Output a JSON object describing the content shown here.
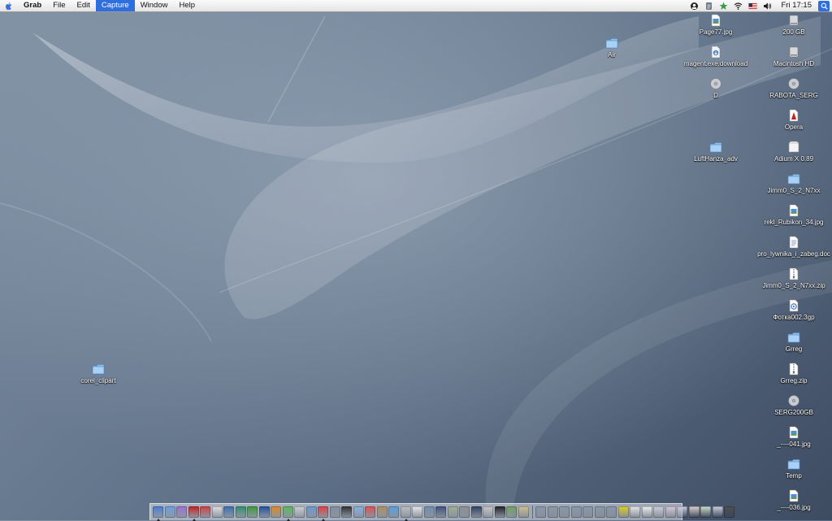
{
  "menubar": {
    "app_name": "Grab",
    "menus": [
      "File",
      "Edit",
      "Capture",
      "Window",
      "Help"
    ],
    "active_menu": "Capture",
    "clock": "Fri 17:15",
    "extras": [
      "activity-monitor-icon",
      "script-menu-icon",
      "bluetooth-star-icon",
      "wifi-icon",
      "us-flag-icon",
      "volume-icon"
    ]
  },
  "desktop_icons": {
    "air": {
      "label": "Air",
      "icon": "folder-icon"
    },
    "page77": {
      "label": "Page77.jpg",
      "icon": "image-file-icon"
    },
    "magent": {
      "label": "magent.exe.download",
      "icon": "download-file-icon"
    },
    "d_drive": {
      "label": "D",
      "icon": "drive-icon"
    },
    "lufthanza": {
      "label": "LuftHanza_adv",
      "icon": "folder-icon"
    },
    "g200": {
      "label": "200 GB",
      "icon": "drive-icon"
    },
    "macintosh_hd": {
      "label": "Macintosh HD",
      "icon": "drive-icon"
    },
    "rabota": {
      "label": "RABOTA_SERG",
      "icon": "network-drive-icon"
    },
    "opera": {
      "label": "Opera",
      "icon": "opera-icon"
    },
    "adium": {
      "label": "Adium X 0.89",
      "icon": "disk-image-icon"
    },
    "jimm_folder": {
      "label": "Jimm0_S_2_N7xx",
      "icon": "folder-icon"
    },
    "rekl": {
      "label": "rekl_Rubikon_34.jpg",
      "icon": "image-file-icon"
    },
    "pro_lywnika": {
      "label": "pro_lywnika_i_zabeg.doc",
      "icon": "document-icon"
    },
    "jimm_zip": {
      "label": "Jimm0_S_2_N7xx.zip",
      "icon": "zip-file-icon"
    },
    "fotka": {
      "label": "Фотка002.3gp",
      "icon": "video-file-icon"
    },
    "grreg": {
      "label": "Grreg",
      "icon": "folder-icon"
    },
    "grreg_zip": {
      "label": "Grreg.zip",
      "icon": "zip-file-icon"
    },
    "serg200": {
      "label": "SERG200GB",
      "icon": "drive-icon"
    },
    "f041": {
      "label": "_----041.jpg",
      "icon": "image-file-icon"
    },
    "temp": {
      "label": "Temp",
      "icon": "folder-icon"
    },
    "f036": {
      "label": "_----036.jpg",
      "icon": "image-file-icon"
    },
    "corel": {
      "label": "corel_clipart",
      "icon": "folder-icon"
    }
  },
  "dock": {
    "apps": [
      {
        "name": "finder-icon",
        "color": "#4a7fd4",
        "running": true
      },
      {
        "name": "safari-icon",
        "color": "#6aa0e0",
        "running": false
      },
      {
        "name": "itunes-icon",
        "color": "#a070d0",
        "running": false
      },
      {
        "name": "opera-icon",
        "color": "#c82020",
        "running": true
      },
      {
        "name": "acrobat-icon",
        "color": "#d04040",
        "running": false
      },
      {
        "name": "preview-icon",
        "color": "#e0e0e0",
        "running": false
      },
      {
        "name": "photoshop-icon",
        "color": "#3a70b0",
        "running": false
      },
      {
        "name": "macromedia-icon",
        "color": "#2f8f6f",
        "running": false
      },
      {
        "name": "dreamweaver-icon",
        "color": "#3c9a3c",
        "running": false
      },
      {
        "name": "firefox-icon",
        "color": "#2050a0",
        "running": false
      },
      {
        "name": "vlc-icon",
        "color": "#e08a20",
        "running": false
      },
      {
        "name": "adium-icon",
        "color": "#5cb85c",
        "running": true
      },
      {
        "name": "pages-icon",
        "color": "#d0d0d0",
        "running": false
      },
      {
        "name": "xcode-icon",
        "color": "#6a9ad0",
        "running": false
      },
      {
        "name": "transmission-icon",
        "color": "#e04040",
        "running": true
      },
      {
        "name": "system-preferences-icon",
        "color": "#8090a0",
        "running": false
      },
      {
        "name": "terminal-icon",
        "color": "#303030",
        "running": false
      },
      {
        "name": "mail-icon",
        "color": "#88b0e0",
        "running": false
      },
      {
        "name": "ical-icon",
        "color": "#e05050",
        "running": false
      },
      {
        "name": "address-book-icon",
        "color": "#b09060",
        "running": false
      },
      {
        "name": "ichat-icon",
        "color": "#5aa0e0",
        "running": false
      },
      {
        "name": "grab-icon",
        "color": "#c0c0c0",
        "running": true
      },
      {
        "name": "textedit-icon",
        "color": "#e8e8e8",
        "running": false
      },
      {
        "name": "utility-icon",
        "color": "#7090b0",
        "running": false
      },
      {
        "name": "network-icon",
        "color": "#405080",
        "running": false
      },
      {
        "name": "chess-icon",
        "color": "#a0b090",
        "running": false
      },
      {
        "name": "calculator-icon",
        "color": "#909090",
        "running": false
      },
      {
        "name": "dashboard-icon",
        "color": "#304060",
        "running": false
      },
      {
        "name": "printer-icon",
        "color": "#c8c8c8",
        "running": false
      },
      {
        "name": "photo-booth-icon",
        "color": "#202020",
        "running": false
      },
      {
        "name": "iphoto-icon",
        "color": "#70a060",
        "running": false
      },
      {
        "name": "books-icon",
        "color": "#d0c090",
        "running": false
      }
    ],
    "docs": [
      {
        "name": "window-minimized-1-icon",
        "color": "#8a98a8"
      },
      {
        "name": "window-minimized-2-icon",
        "color": "#8a98a8"
      },
      {
        "name": "window-minimized-3-icon",
        "color": "#8a98a8"
      },
      {
        "name": "window-minimized-4-icon",
        "color": "#8a98a8"
      },
      {
        "name": "window-minimized-5-icon",
        "color": "#8a98a8"
      },
      {
        "name": "window-minimized-6-icon",
        "color": "#8a98a8"
      },
      {
        "name": "window-minimized-7-icon",
        "color": "#8a98a8"
      },
      {
        "name": "help-icon",
        "color": "#e0d020"
      },
      {
        "name": "keyboard-icon",
        "color": "#e8e8e8"
      },
      {
        "name": "text-doc-icon",
        "color": "#f0f0f0"
      },
      {
        "name": "stack-1-icon",
        "color": "#d0d0e0"
      },
      {
        "name": "stack-2-icon",
        "color": "#d8c8d8"
      },
      {
        "name": "stack-3-icon",
        "color": "#d0d0e0"
      },
      {
        "name": "stack-4-icon",
        "color": "#e0d0d0"
      },
      {
        "name": "stack-5-icon",
        "color": "#d0e0d0"
      },
      {
        "name": "stack-6-icon",
        "color": "#d0d0e0"
      },
      {
        "name": "trash-icon",
        "color": "#505050"
      }
    ]
  }
}
